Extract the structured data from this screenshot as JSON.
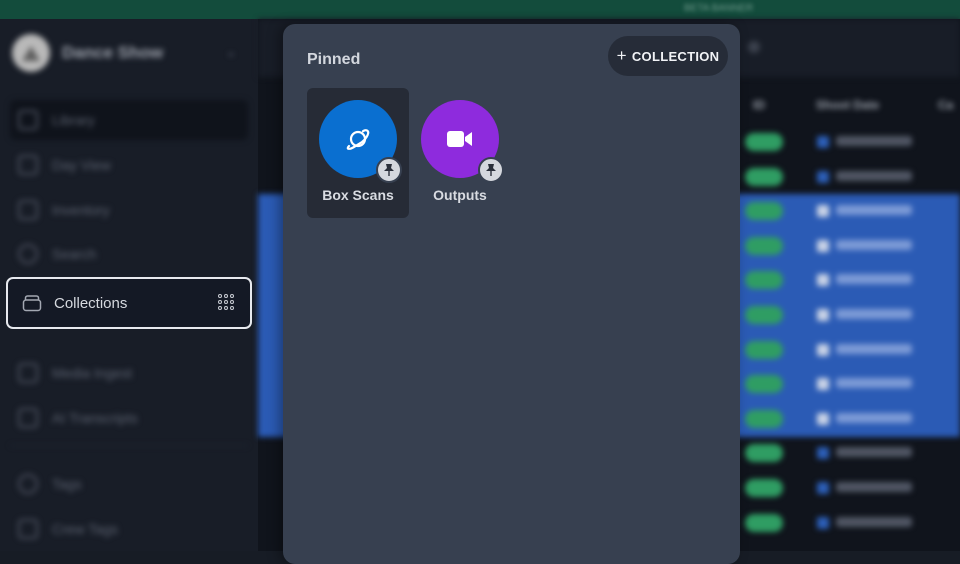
{
  "topbar": {
    "text": "BETA BANNER"
  },
  "sidebar": {
    "workspace_name": "Dance Show",
    "items": [
      {
        "label": "Library",
        "icon": "library-icon"
      },
      {
        "label": "Day View",
        "icon": "calendar-icon"
      },
      {
        "label": "Inventory",
        "icon": "inventory-icon"
      },
      {
        "label": "Search",
        "icon": "search-icon"
      },
      {
        "label": "Collections",
        "icon": "collections-icon",
        "active": true
      },
      {
        "label": "Media Ingest",
        "icon": "ingest-icon"
      },
      {
        "label": "AI Transcripts",
        "icon": "transcript-icon"
      },
      {
        "label": "Tags",
        "icon": "tag-icon"
      },
      {
        "label": "Crew Tags",
        "icon": "crew-tag-icon"
      }
    ]
  },
  "table": {
    "headers": [
      "ID",
      "Shoot Date",
      "Ca"
    ],
    "rows": [
      {
        "selected": false,
        "date": "07/06/2022"
      },
      {
        "selected": false,
        "date": "07/06/2022"
      },
      {
        "selected": true,
        "date": "07/06/2022"
      },
      {
        "selected": true,
        "date": "07/06/2022"
      },
      {
        "selected": true,
        "date": "07/06/2022"
      },
      {
        "selected": true,
        "date": "07/07/2022"
      },
      {
        "selected": true,
        "date": "07/07/2022"
      },
      {
        "selected": true,
        "date": "07/07/2022"
      },
      {
        "selected": true,
        "date": "07/07/2022"
      },
      {
        "selected": false,
        "date": "07/07/2022"
      },
      {
        "selected": false,
        "date": "07/07/2022"
      },
      {
        "selected": false,
        "date": "07/07/2022"
      }
    ]
  },
  "popover": {
    "title": "Pinned",
    "add_button_label": "COLLECTION",
    "collections": [
      {
        "label": "Box Scans",
        "icon": "planet-icon",
        "color": "#0a6fd0",
        "pinned": true,
        "selected": true
      },
      {
        "label": "Outputs",
        "icon": "video-camera-icon",
        "color": "#8e2bdd",
        "pinned": true,
        "selected": false
      }
    ]
  }
}
